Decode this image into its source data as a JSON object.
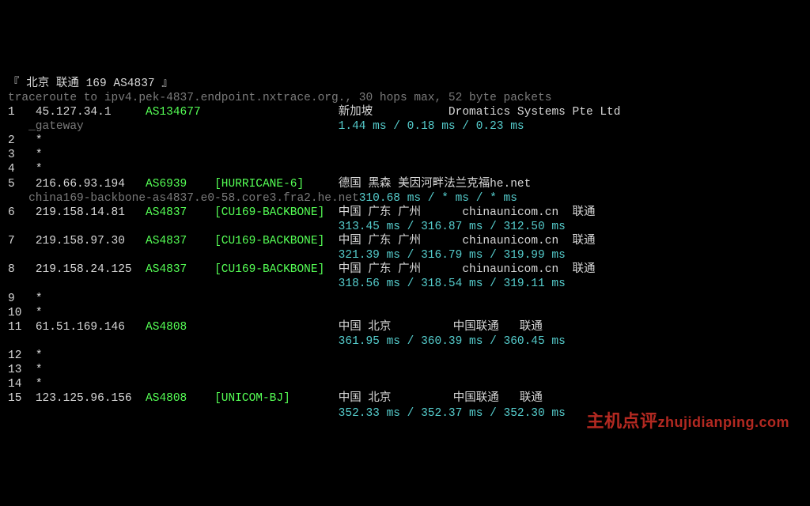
{
  "header": "『 北京 联通 169 AS4837 』",
  "cmd": "traceroute to ipv4.pek-4837.endpoint.nxtrace.org., 30 hops max, 52 byte packets",
  "hops": [
    {
      "n": "1",
      "ip": "45.127.34.1",
      "asn": "AS134677",
      "tag": "",
      "loc": "新加坡",
      "isp": "Dromatics Systems Pte Ltd",
      "ptr": "   _gateway",
      "rtt": "1.44 ms / 0.18 ms / 0.23 ms"
    },
    {
      "n": "2",
      "ip": "*"
    },
    {
      "n": "3",
      "ip": "*"
    },
    {
      "n": "4",
      "ip": "*"
    },
    {
      "n": "5",
      "ip": "216.66.93.194",
      "asn": "AS6939",
      "tag": "[HURRICANE-6]",
      "loc": "德国 黑森 美因河畔法兰克福",
      "isp": "he.net",
      "ptr": "   china169-backbone-as4837.e0-58.core3.fra2.he.net",
      "rtt": "310.68 ms / * ms / * ms"
    },
    {
      "n": "6",
      "ip": "219.158.14.81",
      "asn": "AS4837",
      "tag": "[CU169-BACKBONE]",
      "loc": "中国 广东 广州",
      "isp": "chinaunicom.cn  联通",
      "ptr": "",
      "rtt": "313.45 ms / 316.87 ms / 312.50 ms"
    },
    {
      "n": "7",
      "ip": "219.158.97.30",
      "asn": "AS4837",
      "tag": "[CU169-BACKBONE]",
      "loc": "中国 广东 广州",
      "isp": "chinaunicom.cn  联通",
      "ptr": "",
      "rtt": "321.39 ms / 316.79 ms / 319.99 ms"
    },
    {
      "n": "8",
      "ip": "219.158.24.125",
      "asn": "AS4837",
      "tag": "[CU169-BACKBONE]",
      "loc": "中国 广东 广州",
      "isp": "chinaunicom.cn  联通",
      "ptr": "",
      "rtt": "318.56 ms / 318.54 ms / 319.11 ms"
    },
    {
      "n": "9",
      "ip": "*"
    },
    {
      "n": "10",
      "ip": "*"
    },
    {
      "n": "11",
      "ip": "61.51.169.146",
      "asn": "AS4808",
      "tag": "",
      "loc": "中国 北京",
      "isp": "中国联通   联通",
      "ptr": "",
      "rtt": "361.95 ms / 360.39 ms / 360.45 ms"
    },
    {
      "n": "12",
      "ip": "*"
    },
    {
      "n": "13",
      "ip": "*"
    },
    {
      "n": "14",
      "ip": "*"
    },
    {
      "n": "15",
      "ip": "123.125.96.156",
      "asn": "AS4808",
      "tag": "[UNICOM-BJ]",
      "loc": "中国 北京",
      "isp": "中国联通   联通",
      "ptr": "",
      "rtt": "352.33 ms / 352.37 ms / 352.30 ms"
    }
  ],
  "watermark": {
    "cn": "主机点评",
    "en": "zhujidianping.com"
  }
}
